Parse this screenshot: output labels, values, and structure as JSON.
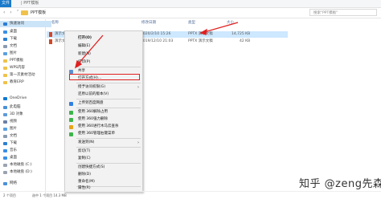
{
  "ribbon": {
    "file_tab": "文件",
    "title": "| PPT模板"
  },
  "address": {
    "folder": "PPT模板",
    "search_placeholder": "搜索\"PPT模板\""
  },
  "columns": {
    "name": "名称",
    "date": "修改日期",
    "type": "类型",
    "size": "大小"
  },
  "files": [
    {
      "name": "演示文稿(1).pptx",
      "date": "2020/2/10 15:26",
      "type": "PPTX 演示文稿",
      "size": "14,725 KB"
    },
    {
      "name": "演示文稿",
      "date": "2019/12/10 21:03",
      "type": "PPTX 演示文稿",
      "size": "42 KB"
    }
  ],
  "sidebar": [
    "快速访问",
    "桌面",
    "下载",
    "文档",
    "图片",
    "PPT模板",
    "WPS内容",
    "第一次素材活动",
    "教育ERP",
    "OneDrive",
    "此电脑",
    "3D 对象",
    "视频",
    "图片",
    "文档",
    "下载",
    "音乐",
    "桌面",
    "本地磁盘 (C:)",
    "本地磁盘 (D:)",
    "网络"
  ],
  "context_menu": {
    "open": "打开(O)",
    "edit": "编辑(E)",
    "new": "新建(N)",
    "print": "打印(P)",
    "share": "共享",
    "open_with": "打开方式(H)...",
    "give_access": "授予访问权限(G)",
    "restore_versions": "还原以前的版本(V)",
    "send_to_home": "上传到百度网盘",
    "scan_360": "使用 360解除占用",
    "delete_360": "使用 360强力删除",
    "virus_360": "使用 360进行木马云查杀",
    "menu_360": "使用 360管理右键菜单",
    "send_to": "发送到(N)",
    "cut": "剪切(T)",
    "copy": "复制(C)",
    "create_shortcut": "创建快捷方式(S)",
    "delete": "删除(D)",
    "rename": "重命名(M)",
    "properties": "属性(R)"
  },
  "status": {
    "items": "2 个项目",
    "selected": "选中 1 个项目 14.3 MB"
  },
  "watermark": "知乎 @zeng先森",
  "colors": {
    "highlight_box": "#e02020",
    "file_tab": "#1979ca",
    "selection": "#cde8ff"
  }
}
